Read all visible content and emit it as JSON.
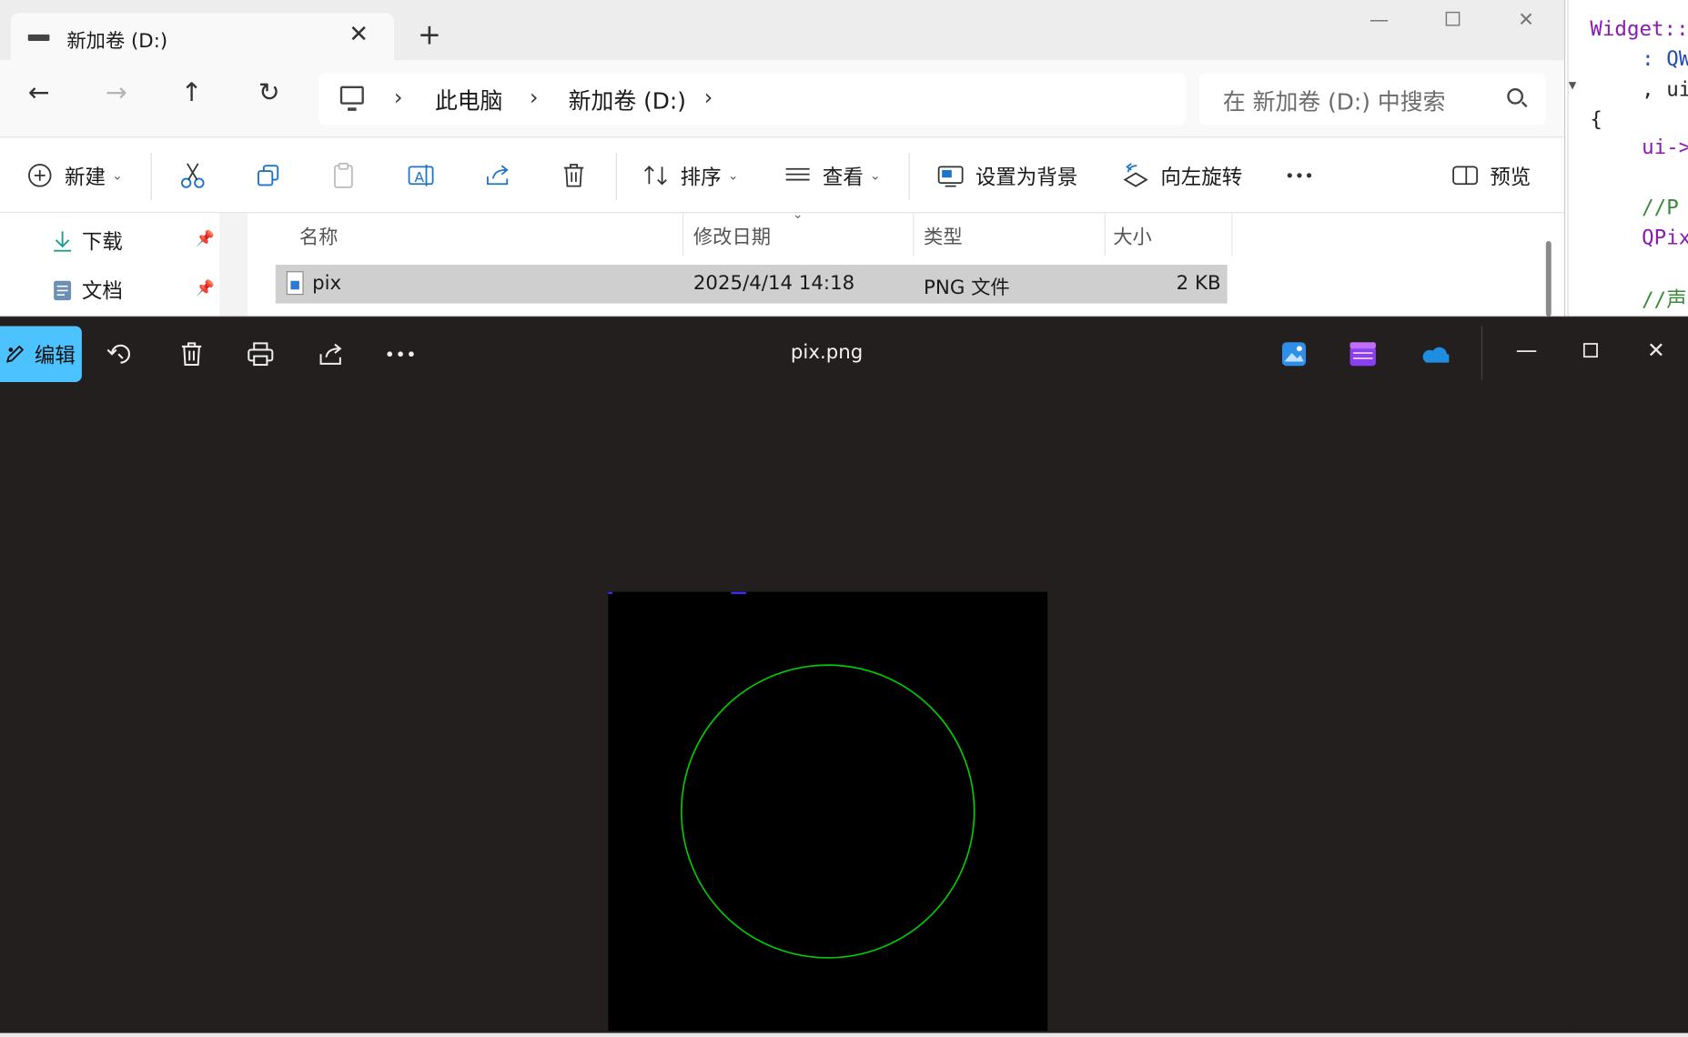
{
  "explorer": {
    "tab_title": "新加卷 (D:)",
    "breadcrumb": [
      "此电脑",
      "新加卷 (D:)"
    ],
    "search_placeholder": "在 新加卷 (D:) 中搜索",
    "commands": {
      "new_label": "新建",
      "sort_label": "排序",
      "view_label": "查看",
      "set_background_label": "设置为背景",
      "rotate_left_label": "向左旋转",
      "preview_label": "预览"
    },
    "nav_items": [
      {
        "label": "下载",
        "icon": "download-icon"
      },
      {
        "label": "文档",
        "icon": "document-icon"
      }
    ],
    "columns": [
      "名称",
      "修改日期",
      "类型",
      "大小"
    ],
    "files": [
      {
        "name": "pix",
        "modified": "2025/4/14 14:18",
        "type": "PNG 文件",
        "size": "2 KB"
      }
    ]
  },
  "viewer": {
    "title": "pix.png",
    "edit_label": "编辑",
    "image": {
      "background": "#000000",
      "circle_color": "#00cc00"
    }
  },
  "code_snippet": {
    "lines": [
      "Widget::",
      ": QW",
      ", ui",
      "{",
      "ui->",
      "//P",
      "QPix",
      "//声"
    ]
  },
  "colors": {
    "accent": "#4cc2ff",
    "viewer_bg": "#241f1f",
    "selection": "#cfcfcf"
  }
}
